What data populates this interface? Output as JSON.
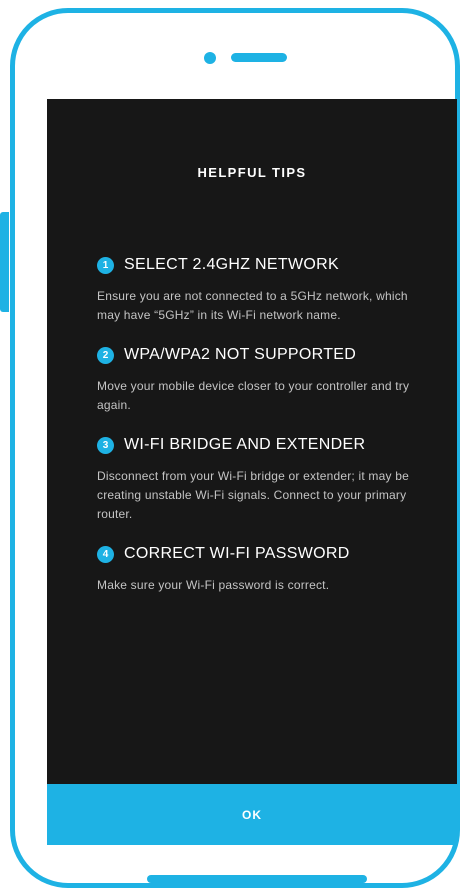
{
  "colors": {
    "accent": "#1eb2e4",
    "screen_background": "#171717",
    "body_text": "#c4c4c4"
  },
  "dialog": {
    "title": "HELPFUL TIPS",
    "tips": [
      {
        "number": "1",
        "title": "SELECT 2.4GHZ NETWORK",
        "body": "Ensure you are not connected to a 5GHz network, which may have “5GHz” in its Wi-Fi network name."
      },
      {
        "number": "2",
        "title": "WPA/WPA2 NOT SUPPORTED",
        "body": "Move your mobile device closer to your controller and try again."
      },
      {
        "number": "3",
        "title": "WI-FI BRIDGE AND EXTENDER",
        "body": "Disconnect from your Wi-Fi bridge or extender; it may be creating unstable Wi-Fi signals. Connect to your primary router."
      },
      {
        "number": "4",
        "title": "CORRECT WI-FI PASSWORD",
        "body": "Make sure your Wi-Fi password is correct."
      }
    ],
    "ok_label": "OK"
  }
}
